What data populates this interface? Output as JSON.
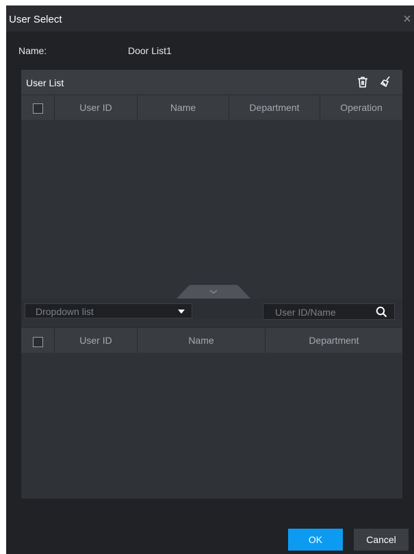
{
  "dialog": {
    "title": "User Select",
    "close_symbol": "×"
  },
  "name_field": {
    "label": "Name:",
    "value": "Door  List1"
  },
  "user_list": {
    "title": "User List",
    "icons": [
      "trash-icon",
      "broom-clear-icon"
    ],
    "columns": [
      "User ID",
      "Name",
      "Department",
      "Operation"
    ],
    "rows": []
  },
  "filter": {
    "dropdown_value": "Dropdown list",
    "search_placeholder": "User ID/Name"
  },
  "available_users": {
    "columns": [
      "User ID",
      "Name",
      "Department"
    ],
    "rows": []
  },
  "buttons": {
    "ok": "OK",
    "cancel": "Cancel"
  },
  "colors": {
    "ok_accent": "#0d9bf2",
    "background": "#202226"
  }
}
